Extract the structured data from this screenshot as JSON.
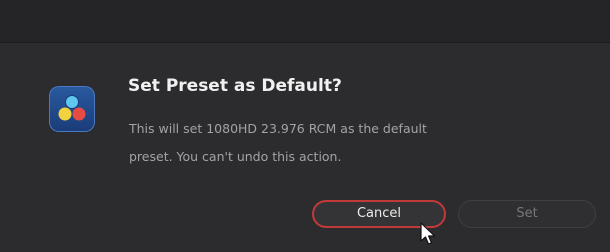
{
  "dialog": {
    "title": "Set Preset as Default?",
    "message": "This will set 1080HD 23.976 RCM as the default preset. You can't undo this action.",
    "icon": "davinci-resolve-app-icon",
    "buttons": {
      "cancel_label": "Cancel",
      "set_label": "Set"
    }
  },
  "colors": {
    "cancel_focus_ring": "#c23939",
    "background": "#2c2c2e"
  }
}
